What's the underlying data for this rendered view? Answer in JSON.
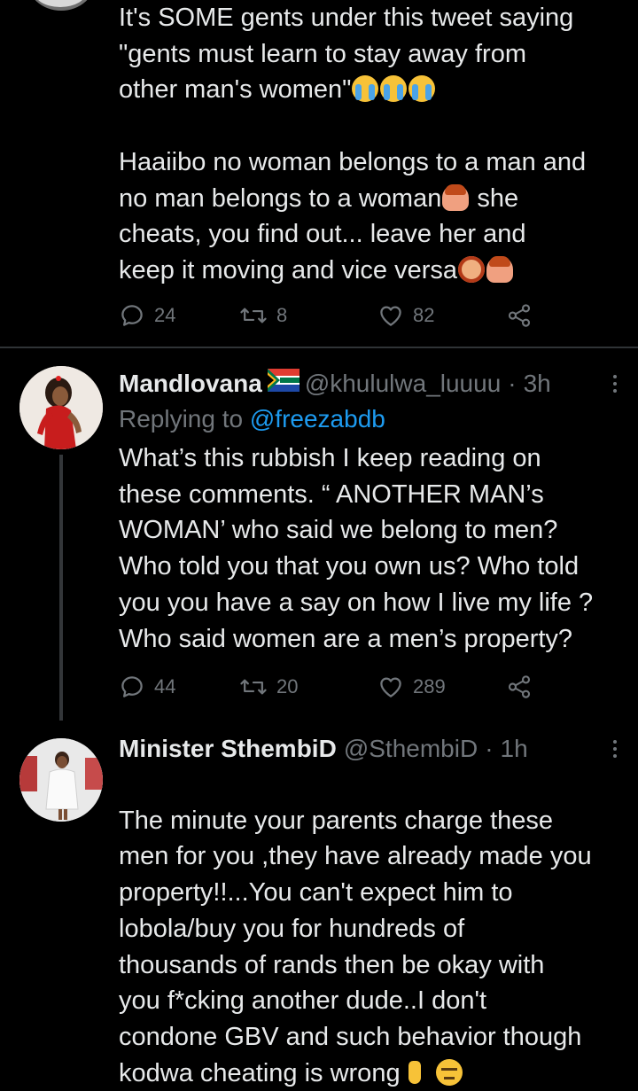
{
  "tweets": [
    {
      "body_lines": [
        "It's SOME gents under this tweet saying",
        "\"gents must learn to stay away from",
        "other man's women\"",
        "",
        "Haaiibo no woman belongs to a man and",
        "no man belongs to a woman",
        "cheats, you find out... leave her and",
        "keep it moving and vice versa"
      ],
      "she_word": "she",
      "replies": "24",
      "retweets": "8",
      "likes": "82"
    },
    {
      "display_name": "Mandlovana",
      "flag": "south-africa-flag",
      "handle": "@khululwa_luuuu",
      "time": "3h",
      "replying_prefix": "Replying to",
      "replying_handle": "@freezabdb",
      "body": "What’s this rubbish I keep reading on\nthese comments. “ ANOTHER MAN’s\nWOMAN’ who said we belong to men?\nWho told you that you own us? Who told\nyou you have a say on how I live my life ?\nWho said women are a men’s property?",
      "replies": "44",
      "retweets": "20",
      "likes": "289"
    },
    {
      "display_name": "Minister SthembiD",
      "handle": "@SthembiD",
      "time": "1h",
      "body": "The minute your parents charge these\nmen for you ,they have already made you\nproperty!!...You can't expect him to\nlobola/buy you for hundreds of\nthousands of rands then be okay with\nyou f*cking another dude..I don't\ncondone GBV and such behavior though\nkodwa cheating is wrong"
    }
  ],
  "dot_separator": "·",
  "icons": [
    "reply-icon",
    "retweet-icon",
    "like-icon",
    "share-icon",
    "more-icon"
  ],
  "colors": {
    "background": "#000000",
    "text": "#e7e9ea",
    "muted": "#71767b",
    "link": "#1d9bf0",
    "divider": "#2f3336"
  }
}
